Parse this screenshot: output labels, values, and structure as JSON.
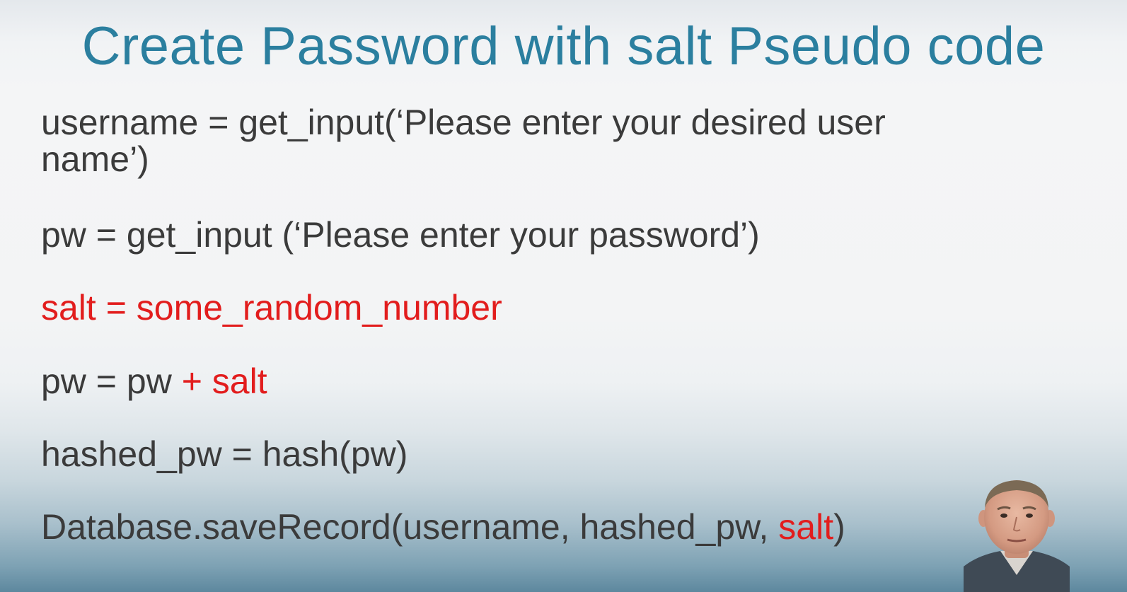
{
  "slide": {
    "title": "Create Password with salt Pseudo code",
    "lines": [
      {
        "parts": [
          "username = get_input(‘Please enter your desired user"
        ]
      },
      {
        "parts": [
          "name’)"
        ]
      },
      {
        "parts": [
          "pw = get_input (‘Please enter your password’)"
        ]
      },
      {
        "parts": [
          "salt = some_random_number"
        ]
      },
      {
        "parts": [
          "pw = pw ",
          "+ salt"
        ]
      },
      {
        "parts": [
          "hashed_pw = hash(pw)"
        ]
      },
      {
        "parts": [
          "Database.saveRecord(username, hashed_pw, ",
          "salt",
          ")"
        ]
      }
    ]
  },
  "colors": {
    "title": "#2b7f9f",
    "code_text": "#3b3b3b",
    "highlight": "#e21d1d"
  }
}
